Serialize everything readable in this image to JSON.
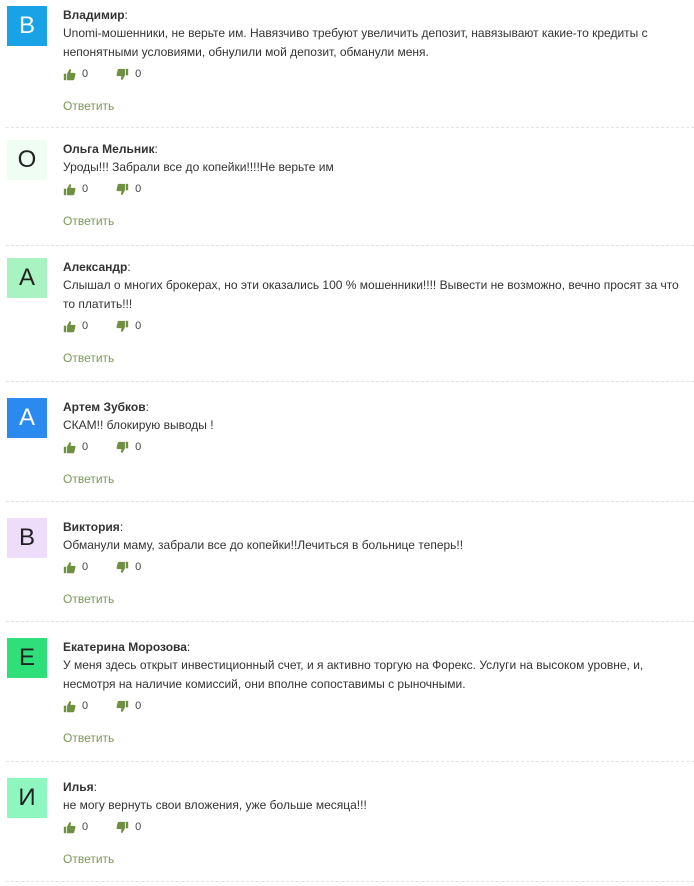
{
  "colors": {
    "accent": "#7a9a55",
    "thumb": "#6f8f42"
  },
  "comments": [
    {
      "initial": "В",
      "avatar_bg": "#1aa2e6",
      "avatar_fg": "#ffffff",
      "author": "Владимир",
      "colon": ":",
      "text": "Unomi-мошенники, не верьте им. Навязчиво требуют увеличить депозит, навязывают какие-то кредиты с непонятными условиями, обнулили мой депозит, обманули меня.",
      "likes": "0",
      "dislikes": "0",
      "reply": "Ответить"
    },
    {
      "initial": "О",
      "avatar_bg": "#effdf3",
      "avatar_fg": "#222222",
      "author": "Ольга Мельник",
      "colon": ":",
      "text": "Уроды!!! Забрали все до копейки!!!!Не верьте им",
      "likes": "0",
      "dislikes": "0",
      "reply": "Ответить"
    },
    {
      "initial": "А",
      "avatar_bg": "#a9f3c2",
      "avatar_fg": "#222222",
      "author": "Александр",
      "colon": ":",
      "text": "Слышал о многих брокерах, но эти оказались 100 % мошенники!!!! Вывести не возможно, вечно просят за что то платить!!!",
      "likes": "0",
      "dislikes": "0",
      "reply": "Ответить"
    },
    {
      "initial": "А",
      "avatar_bg": "#2a8af0",
      "avatar_fg": "#ffffff",
      "author": "Артем Зубков",
      "colon": ":",
      "text": "СКАМ!! блокирую выводы !",
      "likes": "0",
      "dislikes": "0",
      "reply": "Ответить"
    },
    {
      "initial": "В",
      "avatar_bg": "#eedcfb",
      "avatar_fg": "#222222",
      "author": "Виктория",
      "colon": ":",
      "text": "Обманули маму, забрали все до копейки!!Лечиться в больнице теперь!!",
      "likes": "0",
      "dislikes": "0",
      "reply": "Ответить"
    },
    {
      "initial": "Е",
      "avatar_bg": "#2fe07a",
      "avatar_fg": "#222222",
      "author": "Екатерина Морозова",
      "colon": ":",
      "text": "У меня здесь открыт инвестиционный счет, и я активно торгую на Форекс. Услуги на высоком уровне, и, несмотря на наличие комиссий, они вполне сопоставимы с рыночными.",
      "likes": "0",
      "dislikes": "0",
      "reply": "Ответить"
    },
    {
      "initial": "И",
      "avatar_bg": "#8ef7c0",
      "avatar_fg": "#222222",
      "author": "Илья",
      "colon": ":",
      "text": "не могу вернуть свои вложения, уже больше месяца!!!",
      "likes": "0",
      "dislikes": "0",
      "reply": "Ответить"
    }
  ]
}
